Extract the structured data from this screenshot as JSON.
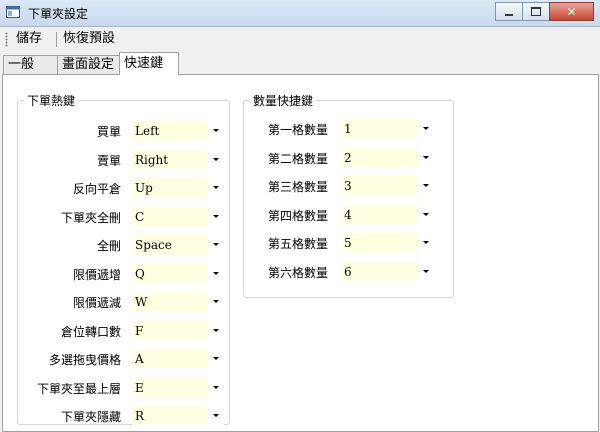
{
  "window": {
    "title": "下單夾設定"
  },
  "toolbar": {
    "save_label": "儲存",
    "restore_label": "恢復預設"
  },
  "tabs": [
    {
      "label": "一般",
      "active": false
    },
    {
      "label": "畫面設定",
      "active": false
    },
    {
      "label": "快速鍵",
      "active": true
    }
  ],
  "order_hotkeys": {
    "title": "下單熱鍵",
    "rows": [
      {
        "label": "買單",
        "value": "Left"
      },
      {
        "label": "賣單",
        "value": "Right"
      },
      {
        "label": "反向平倉",
        "value": "Up"
      },
      {
        "label": "下單夾全刪",
        "value": "C"
      },
      {
        "label": "全刪",
        "value": "Space"
      },
      {
        "label": "限價遞增",
        "value": "Q"
      },
      {
        "label": "限價遞減",
        "value": "W"
      },
      {
        "label": "倉位轉口數",
        "value": "F"
      },
      {
        "label": "多選拖曳價格",
        "value": "A"
      },
      {
        "label": "下單夾至最上層",
        "value": "E"
      },
      {
        "label": "下單夾隱藏",
        "value": "R"
      }
    ]
  },
  "quantity_hotkeys": {
    "title": "數量快捷鍵",
    "rows": [
      {
        "label": "第一格數量",
        "value": "1"
      },
      {
        "label": "第二格數量",
        "value": "2"
      },
      {
        "label": "第三格數量",
        "value": "3"
      },
      {
        "label": "第四格數量",
        "value": "4"
      },
      {
        "label": "第五格數量",
        "value": "5"
      },
      {
        "label": "第六格數量",
        "value": "6"
      }
    ]
  },
  "colors": {
    "input_bg": "#ffffe1",
    "titlebar": "#c7d9ee",
    "close_button": "#c7472d"
  }
}
